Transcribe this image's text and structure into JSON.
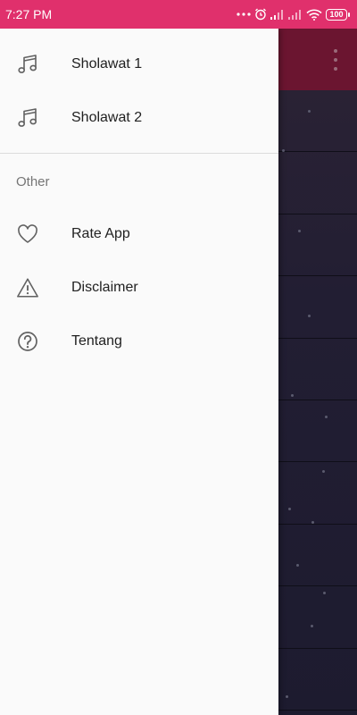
{
  "status_bar": {
    "time": "7:27 PM",
    "battery": "100",
    "icons": [
      "more-dots-icon",
      "alarm-icon",
      "signal-icon",
      "signal-icon",
      "wifi-icon",
      "battery-icon"
    ],
    "color": "#e0306c"
  },
  "background_app": {
    "toolbar_icon": "overflow-menu-icon"
  },
  "drawer": {
    "items": [
      {
        "label": "Sholawat 1",
        "icon": "music-note-icon"
      },
      {
        "label": "Sholawat 2",
        "icon": "music-note-icon"
      }
    ],
    "other_section": {
      "header": "Other",
      "items": [
        {
          "label": "Rate App",
          "icon": "heart-icon"
        },
        {
          "label": "Disclaimer",
          "icon": "warning-icon"
        },
        {
          "label": "Tentang",
          "icon": "help-circle-icon"
        }
      ]
    }
  }
}
